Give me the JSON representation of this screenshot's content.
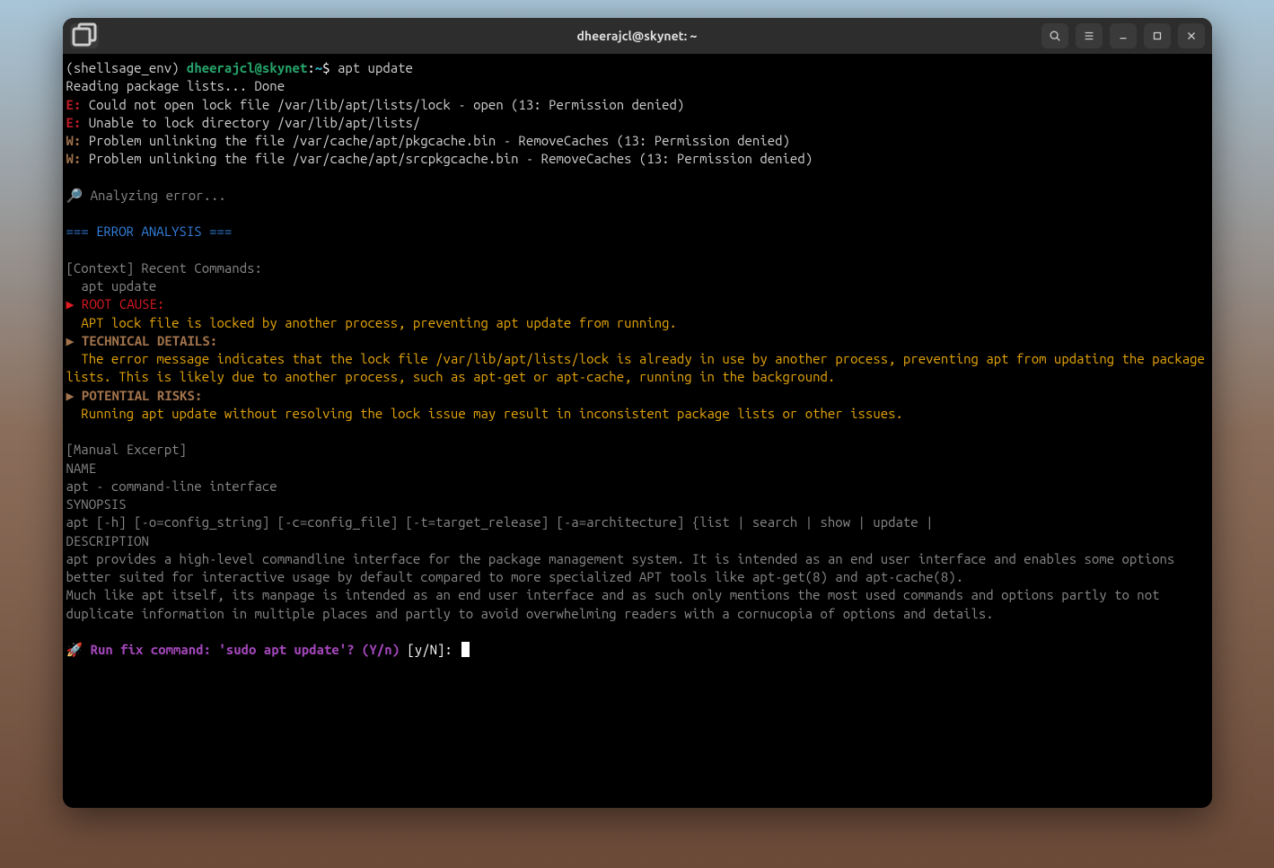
{
  "titlebar": {
    "title": "dheerajcl@skynet: ~"
  },
  "prompt": {
    "env": "(shellsage_env)",
    "user_host": "dheerajcl@skynet",
    "separator": ":",
    "path": "~",
    "dollar": "$",
    "command": "apt update"
  },
  "output": {
    "reading": "Reading package lists... Done",
    "errors": [
      {
        "prefix": "E:",
        "text": " Could not open lock file /var/lib/apt/lists/lock - open (13: Permission denied)"
      },
      {
        "prefix": "E:",
        "text": " Unable to lock directory /var/lib/apt/lists/"
      }
    ],
    "warnings": [
      {
        "prefix": "W:",
        "text": " Problem unlinking the file /var/cache/apt/pkgcache.bin - RemoveCaches (13: Permission denied)"
      },
      {
        "prefix": "W:",
        "text": " Problem unlinking the file /var/cache/apt/srcpkgcache.bin - RemoveCaches (13: Permission denied)"
      }
    ]
  },
  "analysis": {
    "analyzing_icon": "🔎",
    "analyzing": " Analyzing error...",
    "header": "=== ERROR ANALYSIS ===",
    "context_label": "[Context] Recent Commands:",
    "context_cmd": "  apt update",
    "root_cause_arrow": "▶",
    "root_cause_label": " ROOT CAUSE:",
    "root_cause_text": "  APT lock file is locked by another process, preventing apt update from running.",
    "tech_details_arrow": "▶",
    "tech_details_label": " TECHNICAL DETAILS:",
    "tech_details_text": "  The error message indicates that the lock file /var/lib/apt/lists/lock is already in use by another process, preventing apt from updating the package lists. This is likely due to another process, such as apt-get or apt-cache, running in the background.",
    "risks_arrow": "▶",
    "risks_label": " POTENTIAL RISKS:",
    "risks_text": "  Running apt update without resolving the lock issue may result in inconsistent package lists or other issues."
  },
  "manual": {
    "excerpt_label": "[Manual Excerpt]",
    "name_label": "NAME",
    "name_text": "apt - command-line interface",
    "synopsis_label": "SYNOPSIS",
    "synopsis_text": "apt [-h] [-o=config_string] [-c=config_file] [-t=target_release] [-a=architecture] {list | search | show | update |",
    "description_label": "DESCRIPTION",
    "description_text1": "apt provides a high-level commandline interface for the package management system. It is intended as an end user interface and enables some options better suited for interactive usage by default compared to more specialized APT tools like apt-get(8) and apt-cache(8).",
    "description_text2": "Much like apt itself, its manpage is intended as an end user interface and as such only mentions the most used commands and options partly to not duplicate information in multiple places and partly to avoid overwhelming readers with a cornucopia of options and details."
  },
  "fix_prompt": {
    "icon": "🚀",
    "text": " Run fix command: 'sudo apt update'? (Y/n)",
    "input_prompt": " [y/N]: "
  }
}
